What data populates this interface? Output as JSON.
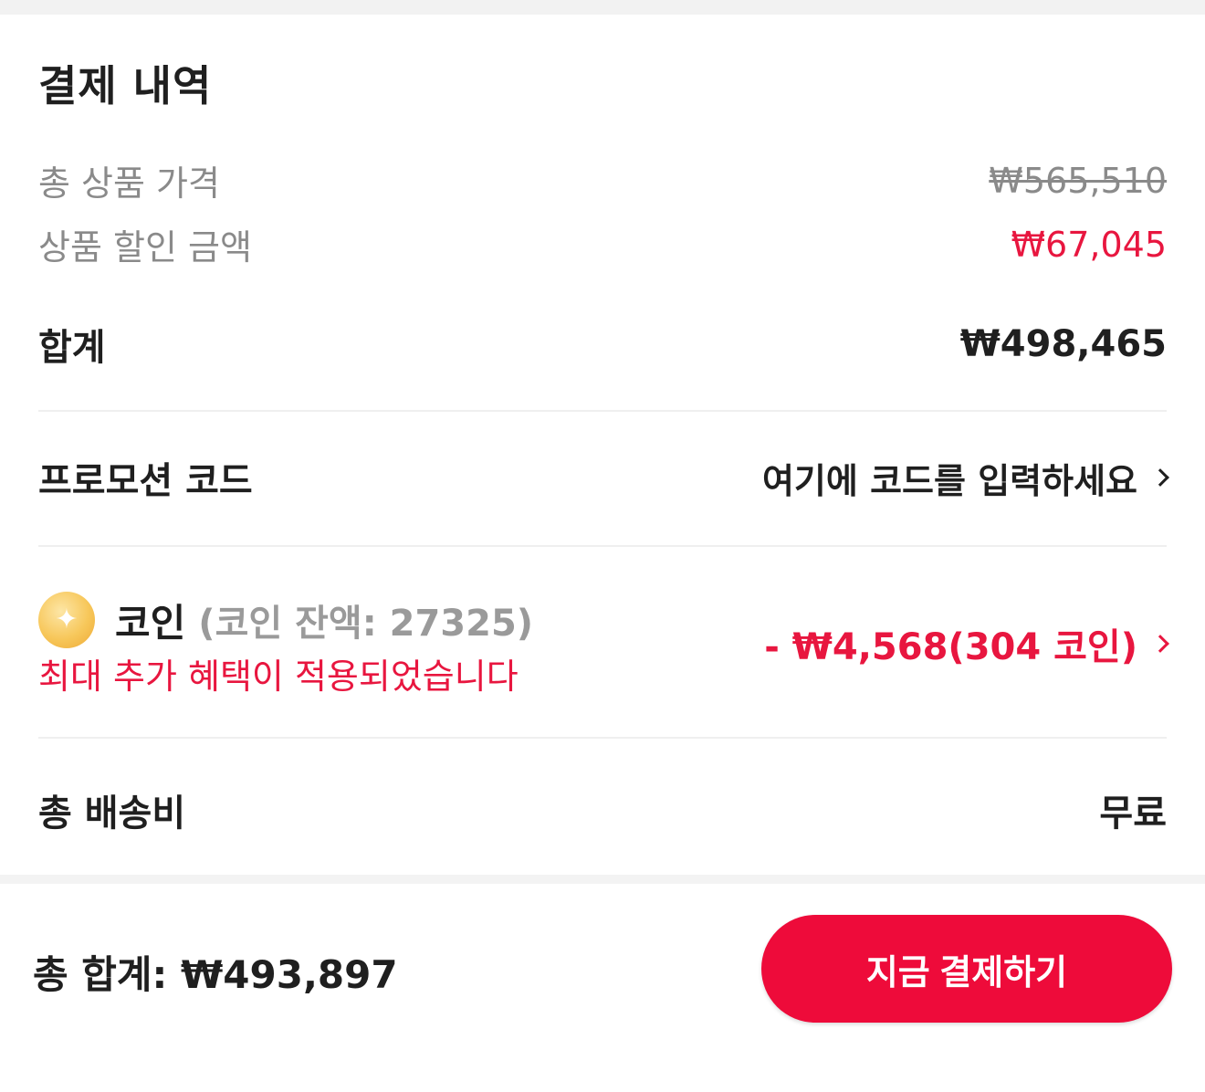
{
  "summary": {
    "title": "결제 내역",
    "total_product_price_label": "총 상품 가격",
    "total_product_price_value": "₩565,510",
    "discount_label": "상품 할인 금액",
    "discount_value": "₩67,045",
    "subtotal_label": "합계",
    "subtotal_value": "₩498,465"
  },
  "promo": {
    "label": "프로모션 코드",
    "placeholder": "여기에 코드를 입력하세요"
  },
  "coin": {
    "icon": "coin-icon",
    "label": "코인",
    "balance": "(코인 잔액: 27325)",
    "note": "최대 추가 혜택이 적용되었습니다",
    "value": "- ₩4,568(304 코인)"
  },
  "shipping": {
    "label": "총 배송비",
    "value": "무료"
  },
  "footer": {
    "total": "총 합계: ₩493,897",
    "pay_button": "지금 결제하기"
  },
  "colors": {
    "accent_red": "#e8163f",
    "button_red": "#ee0b3a"
  }
}
